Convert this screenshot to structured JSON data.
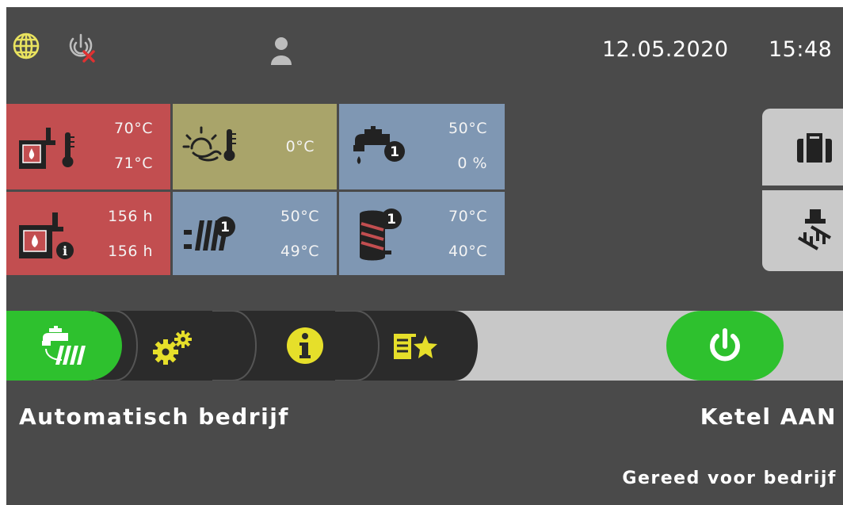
{
  "status_bar": {
    "language_icon": "globe-icon",
    "remote_icon": "remote-disabled-icon",
    "user_icon": "user-icon",
    "date": "12.05.2020",
    "time": "15:48"
  },
  "tiles": {
    "boiler_temp": {
      "icon": "boiler-thermometer-icon",
      "value_top": "70°C",
      "value_bottom": "71°C",
      "color": "#c24e50"
    },
    "outdoor_temp": {
      "icon": "outdoor-sun-thermometer-icon",
      "value": "0°C",
      "color": "#a9a46a"
    },
    "hot_water": {
      "icon": "tap-circuit-1-icon",
      "value_top": "50°C",
      "value_bottom": "0 %",
      "color": "#7f97b3"
    },
    "boiler_hours": {
      "icon": "boiler-info-icon",
      "value_top": "156 h",
      "value_bottom": "156 h",
      "color": "#c24e50"
    },
    "heating_circuit": {
      "icon": "radiator-circuit-1-icon",
      "value_top": "50°C",
      "value_bottom": "49°C",
      "color": "#7f97b3"
    },
    "buffer_tank": {
      "icon": "tank-1-icon",
      "value_top": "70°C",
      "value_bottom": "40°C",
      "color": "#7f97b3"
    }
  },
  "side_buttons": {
    "holiday": {
      "icon": "suitcase-icon"
    },
    "chimney_sweep": {
      "icon": "chimney-sweep-icon"
    }
  },
  "nav_bar": {
    "mode_tab": {
      "icon": "tap-radiator-icon",
      "color": "#2ec12e"
    },
    "settings_tab": {
      "icon": "gears-icon"
    },
    "info_tab": {
      "icon": "info-icon"
    },
    "favorites_tab": {
      "icon": "list-star-icon"
    },
    "power_button": {
      "icon": "power-icon",
      "color": "#2ec12e"
    }
  },
  "status": {
    "mode_label": "Automatisch bedrijf",
    "boiler_state": "Ketel AAN",
    "ready_text": "Gereed voor bedrijf"
  },
  "colors": {
    "background": "#4a4a4a",
    "accent_green": "#2ec12e",
    "icon_yellow": "#e6df2a"
  }
}
